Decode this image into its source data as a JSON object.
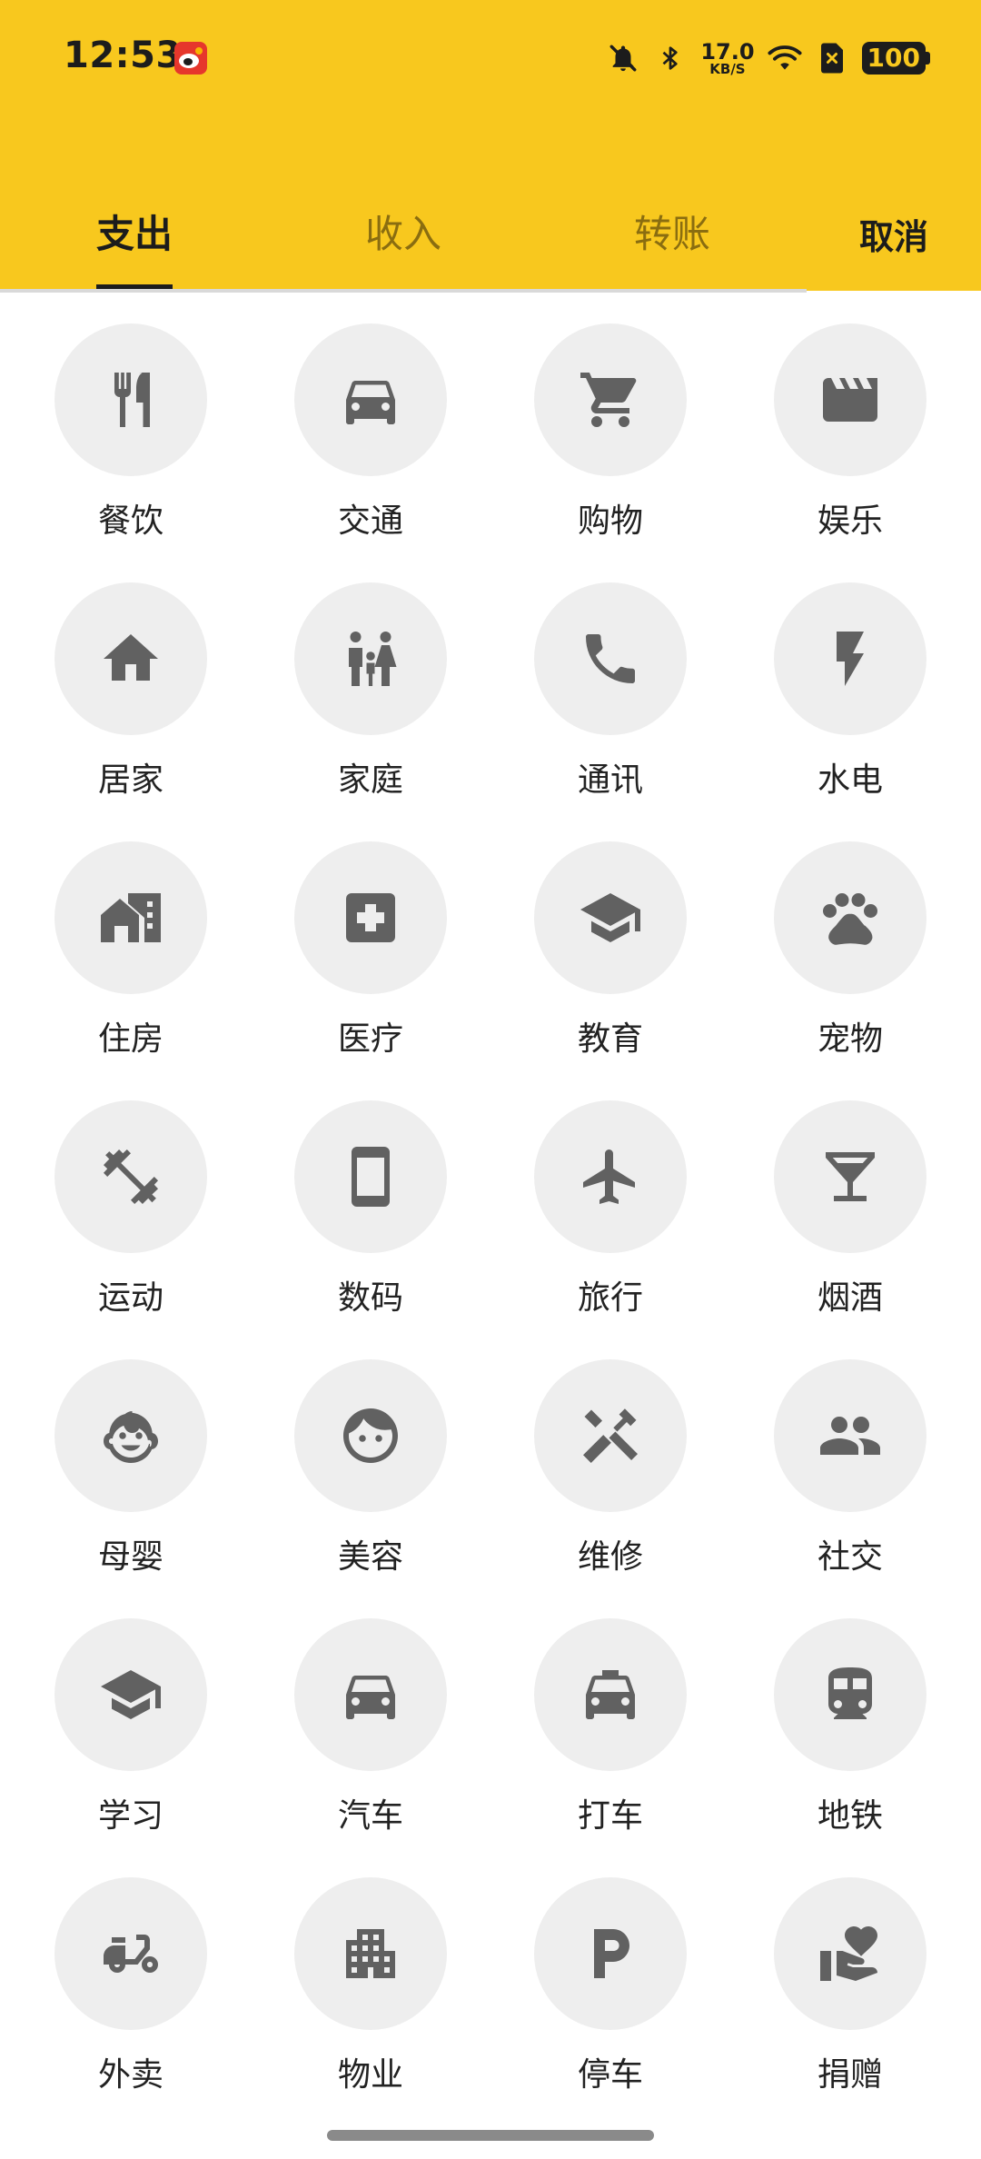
{
  "status_bar": {
    "time": "12:53",
    "net_speed_value": "17.0",
    "net_speed_unit": "KB/S",
    "battery": "100"
  },
  "tabs": [
    {
      "label": "支出",
      "active": true
    },
    {
      "label": "收入",
      "active": false
    },
    {
      "label": "转账",
      "active": false
    }
  ],
  "cancel_label": "取消",
  "colors": {
    "header_bg": "#F8C81E",
    "icon_circle_bg": "#EEEEEE",
    "icon_color": "#616161"
  },
  "categories": [
    {
      "label": "餐饮",
      "icon": "restaurant-icon"
    },
    {
      "label": "交通",
      "icon": "car-icon"
    },
    {
      "label": "购物",
      "icon": "shopping-cart-icon"
    },
    {
      "label": "娱乐",
      "icon": "movie-clapper-icon"
    },
    {
      "label": "居家",
      "icon": "home-icon"
    },
    {
      "label": "家庭",
      "icon": "family-icon"
    },
    {
      "label": "通讯",
      "icon": "phone-icon"
    },
    {
      "label": "水电",
      "icon": "lightning-icon"
    },
    {
      "label": "住房",
      "icon": "house-building-icon"
    },
    {
      "label": "医疗",
      "icon": "medical-cross-icon"
    },
    {
      "label": "教育",
      "icon": "graduation-cap-icon"
    },
    {
      "label": "宠物",
      "icon": "paw-icon"
    },
    {
      "label": "运动",
      "icon": "dumbbell-icon"
    },
    {
      "label": "数码",
      "icon": "smartphone-icon"
    },
    {
      "label": "旅行",
      "icon": "airplane-icon"
    },
    {
      "label": "烟酒",
      "icon": "cocktail-glass-icon"
    },
    {
      "label": "母婴",
      "icon": "baby-face-icon"
    },
    {
      "label": "美容",
      "icon": "face-icon"
    },
    {
      "label": "维修",
      "icon": "tools-icon"
    },
    {
      "label": "社交",
      "icon": "people-icon"
    },
    {
      "label": "学习",
      "icon": "graduation-cap-icon"
    },
    {
      "label": "汽车",
      "icon": "car-icon"
    },
    {
      "label": "打车",
      "icon": "taxi-icon"
    },
    {
      "label": "地铁",
      "icon": "subway-icon"
    },
    {
      "label": "外卖",
      "icon": "scooter-icon"
    },
    {
      "label": "物业",
      "icon": "apartment-icon"
    },
    {
      "label": "停车",
      "icon": "parking-icon"
    },
    {
      "label": "捐赠",
      "icon": "donation-hand-heart-icon"
    }
  ]
}
